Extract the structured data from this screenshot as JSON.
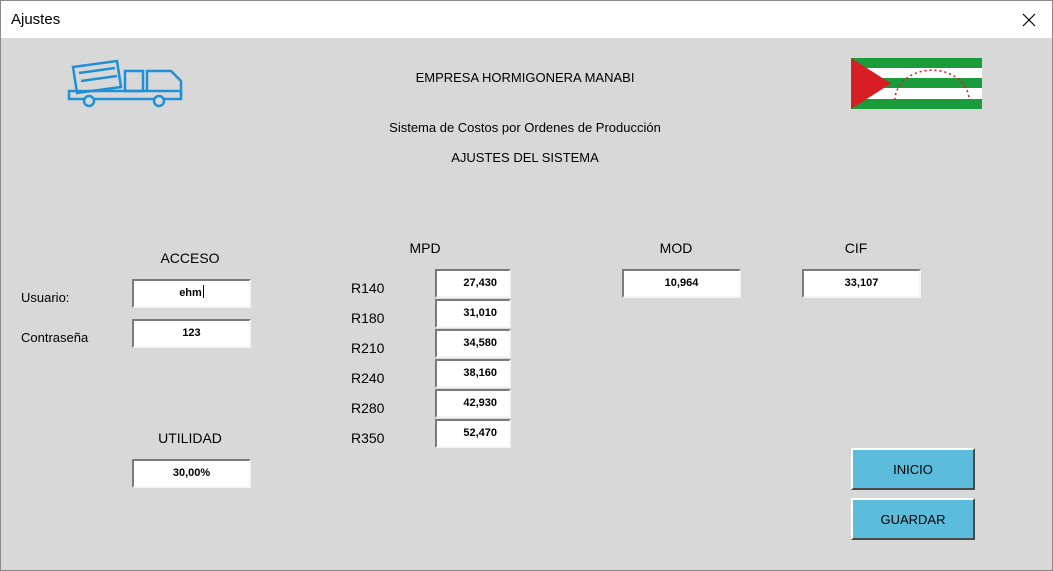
{
  "window": {
    "title": "Ajustes"
  },
  "header": {
    "company": "EMPRESA HORMIGONERA MANABI",
    "system": "Sistema de Costos por Ordenes de Producción",
    "section": "AJUSTES DEL SISTEMA"
  },
  "colors": {
    "button": "#5bbcdc",
    "truck_icon": "#1e90d6",
    "flag_green": "#1a9b3c",
    "flag_red": "#d81e25"
  },
  "acceso": {
    "heading": "ACCESO",
    "user_label": "Usuario:",
    "user_value": "ehm",
    "password_label": "Contraseña",
    "password_value": "123"
  },
  "utilidad": {
    "heading": "UTILIDAD",
    "value": "30,00%"
  },
  "mpd": {
    "heading": "MPD",
    "rows": [
      {
        "label": "R140",
        "value": "27,430"
      },
      {
        "label": "R180",
        "value": "31,010"
      },
      {
        "label": "R210",
        "value": "34,580"
      },
      {
        "label": "R240",
        "value": "38,160"
      },
      {
        "label": "R280",
        "value": "42,930"
      },
      {
        "label": "R350",
        "value": "52,470"
      }
    ]
  },
  "mod": {
    "heading": "MOD",
    "value": "10,964"
  },
  "cif": {
    "heading": "CIF",
    "value": "33,107"
  },
  "buttons": {
    "inicio": "INICIO",
    "guardar": "GUARDAR"
  }
}
